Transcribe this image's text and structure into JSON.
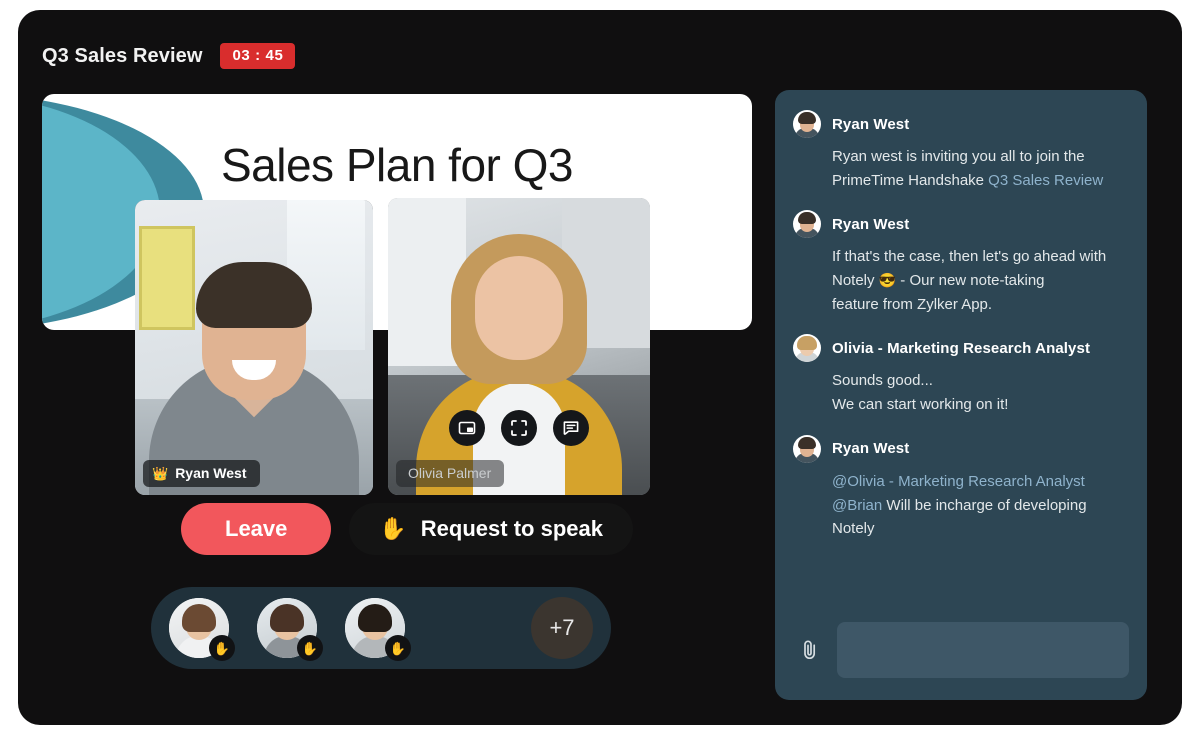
{
  "header": {
    "title": "Q3 Sales Review",
    "timer": "03 : 45",
    "timer_color": "#d92d2d"
  },
  "slide": {
    "title": "Sales Plan for Q3",
    "accent_light": "#5cb5c8",
    "accent_dark": "#3e8a9e"
  },
  "video_tiles": [
    {
      "name": "Ryan West",
      "is_host": true,
      "crown_icon": "crown-icon",
      "crown_glyph": "👑"
    },
    {
      "name": "Olivia Palmer",
      "is_host": false
    }
  ],
  "tile_controls": [
    {
      "icon": "picture-in-picture-icon"
    },
    {
      "icon": "fullscreen-icon"
    },
    {
      "icon": "chat-bubble-icon"
    }
  ],
  "actions": {
    "leave_label": "Leave",
    "leave_color": "#f2575c",
    "request_label": "Request to speak",
    "request_icon": "raised-hand-icon",
    "request_glyph": "✋"
  },
  "participants": {
    "raise_hand_glyph": "✋",
    "avatars": [
      {
        "alt": "participant-1"
      },
      {
        "alt": "participant-2"
      },
      {
        "alt": "participant-3"
      }
    ],
    "overflow_label": "+7"
  },
  "chat": {
    "link_color": "#8fb3cc",
    "messages": [
      {
        "author": "Ryan West",
        "avatar": "ryan-avatar",
        "line1": "Ryan  west is inviting you all to join the",
        "line2_plain": "PrimeTime Handshake ",
        "line2_link": "Q3 Sales Review"
      },
      {
        "author": "Ryan West",
        "avatar": "ryan-avatar",
        "line1": "If that's the case, then let's go ahead with",
        "line2_pre": "Notely ",
        "emoji": "😎",
        "line2_post": " - Our new note-taking",
        "line3": "feature from Zylker App."
      },
      {
        "author": "Olivia - Marketing Research Analyst",
        "avatar": "olivia-avatar",
        "line1": "Sounds good...",
        "line2": "We can start working on it!"
      },
      {
        "author": "Ryan West",
        "avatar": "ryan-avatar",
        "mention1": "@Olivia - Marketing Research Analyst",
        "mention2": "@Brian",
        "line2_post": " Will be incharge of developing",
        "line3": "Notely"
      }
    ],
    "composer": {
      "attach_icon": "paperclip-icon",
      "input_value": "",
      "input_placeholder": ""
    }
  }
}
